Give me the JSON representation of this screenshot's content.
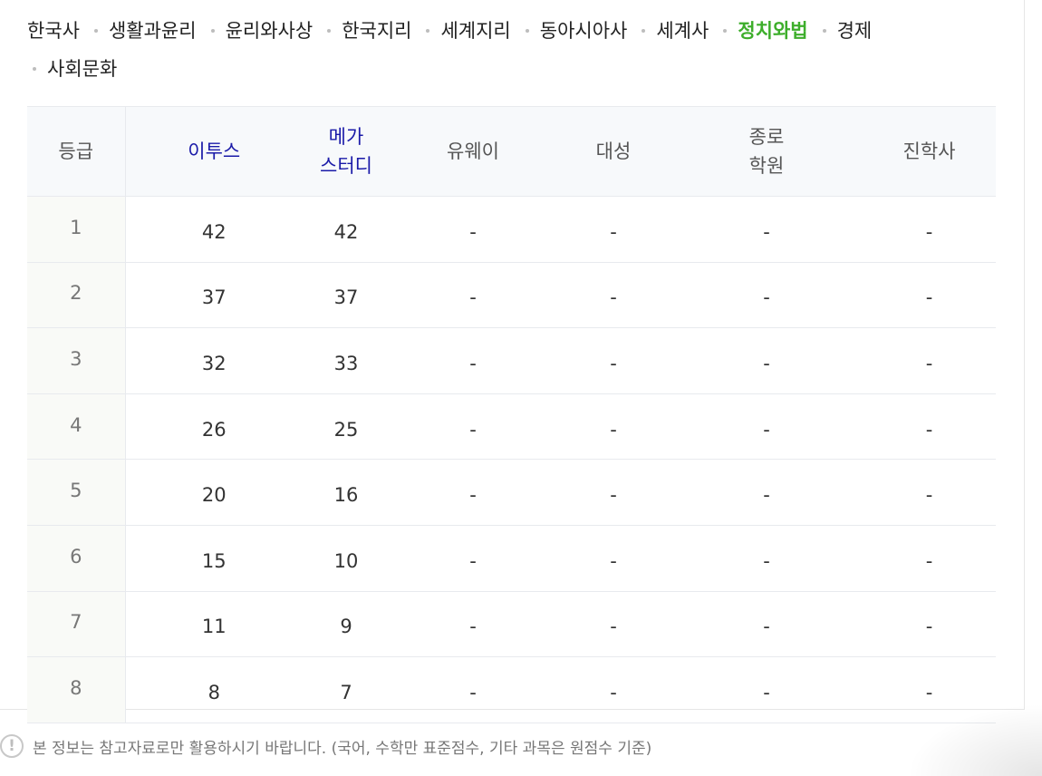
{
  "subject_tabs": [
    {
      "label": "한국사",
      "active": false
    },
    {
      "label": "생활과윤리",
      "active": false
    },
    {
      "label": "윤리와사상",
      "active": false
    },
    {
      "label": "한국지리",
      "active": false
    },
    {
      "label": "세계지리",
      "active": false
    },
    {
      "label": "동아시아사",
      "active": false
    },
    {
      "label": "세계사",
      "active": false
    },
    {
      "label": "정치와법",
      "active": true
    },
    {
      "label": "경제",
      "active": false
    },
    {
      "label": "사회문화",
      "active": false
    }
  ],
  "colors": {
    "active_tab": "#3dae2b",
    "link_header": "#1a1aa8"
  },
  "table": {
    "headers": {
      "grade": "등급",
      "etoos": "이투스",
      "megastudy_line1": "메가",
      "megastudy_line2": "스터디",
      "uway": "유웨이",
      "daesung": "대성",
      "jongro_line1": "종로",
      "jongro_line2": "학원",
      "jinhak": "진학사"
    },
    "rows": [
      {
        "grade": "1",
        "etoos": "42",
        "mega": "42",
        "uway": "-",
        "daesung": "-",
        "jongro": "-",
        "jinhak": "-"
      },
      {
        "grade": "2",
        "etoos": "37",
        "mega": "37",
        "uway": "-",
        "daesung": "-",
        "jongro": "-",
        "jinhak": "-"
      },
      {
        "grade": "3",
        "etoos": "32",
        "mega": "33",
        "uway": "-",
        "daesung": "-",
        "jongro": "-",
        "jinhak": "-"
      },
      {
        "grade": "4",
        "etoos": "26",
        "mega": "25",
        "uway": "-",
        "daesung": "-",
        "jongro": "-",
        "jinhak": "-"
      },
      {
        "grade": "5",
        "etoos": "20",
        "mega": "16",
        "uway": "-",
        "daesung": "-",
        "jongro": "-",
        "jinhak": "-"
      },
      {
        "grade": "6",
        "etoos": "15",
        "mega": "10",
        "uway": "-",
        "daesung": "-",
        "jongro": "-",
        "jinhak": "-"
      },
      {
        "grade": "7",
        "etoos": "11",
        "mega": "9",
        "uway": "-",
        "daesung": "-",
        "jongro": "-",
        "jinhak": "-"
      },
      {
        "grade": "8",
        "etoos": "8",
        "mega": "7",
        "uway": "-",
        "daesung": "-",
        "jongro": "-",
        "jinhak": "-"
      }
    ]
  },
  "notice": {
    "icon": "exclamation-icon",
    "text": "본 정보는 참고자료로만 활용하시기 바랍니다. (국어, 수학만 표준점수, 기타 과목은 원점수 기준)"
  }
}
